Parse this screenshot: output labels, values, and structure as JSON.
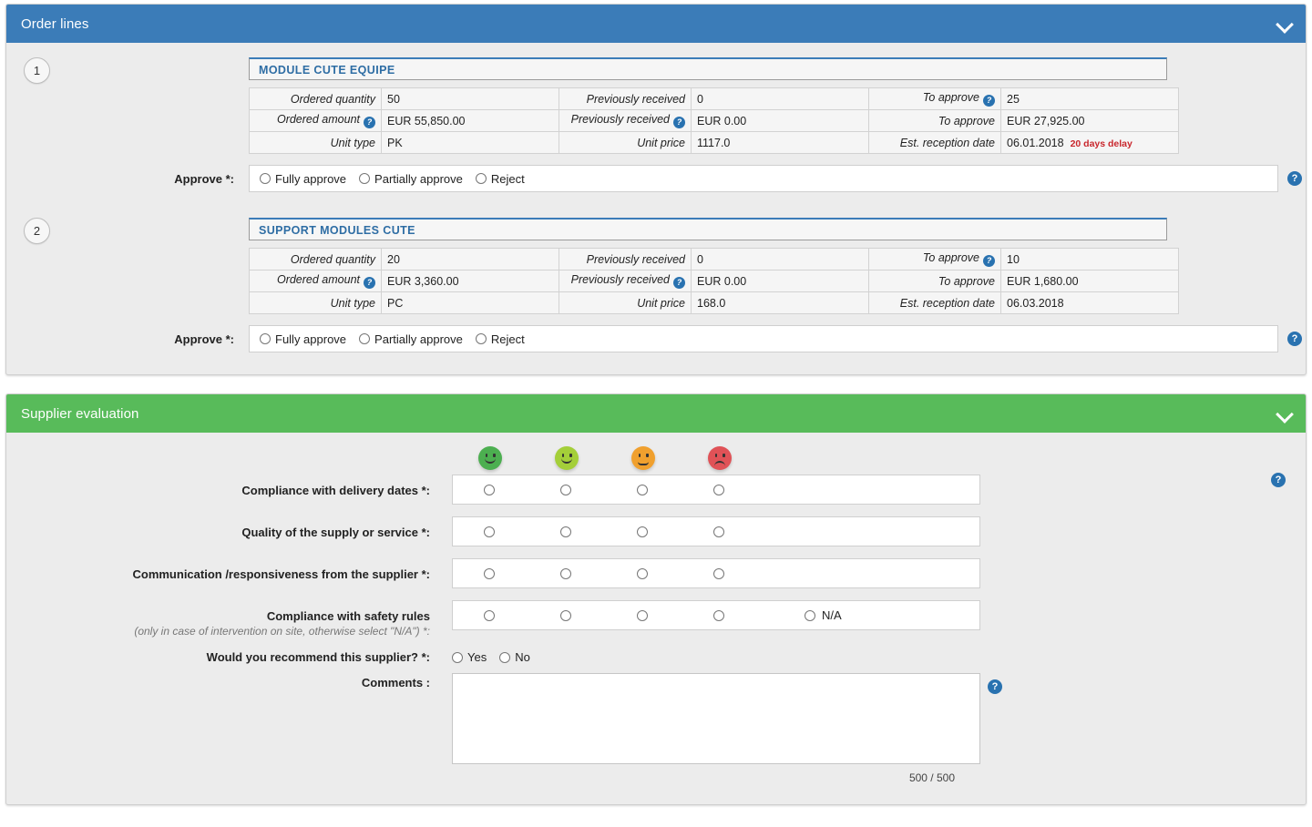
{
  "order_lines_panel": {
    "title": "Order lines",
    "collapse_icon": "chevron-down-icon",
    "lines": [
      {
        "step": "1",
        "title": "MODULE CUTE EQUIPE",
        "rows": [
          {
            "c1_label": "Ordered quantity",
            "c1_help": false,
            "c1_value": "50",
            "c2_label": "Previously received",
            "c2_help": false,
            "c2_value": "0",
            "c3_label": "To approve",
            "c3_help": true,
            "c3_value": "25"
          },
          {
            "c1_label": "Ordered amount",
            "c1_help": true,
            "c1_value": "EUR 55,850.00",
            "c2_label": "Previously received",
            "c2_help": true,
            "c2_value": "EUR 0.00",
            "c3_label": "To approve",
            "c3_help": false,
            "c3_value": "EUR 27,925.00"
          },
          {
            "c1_label": "Unit type",
            "c1_help": false,
            "c1_value": "PK",
            "c2_label": "Unit price",
            "c2_help": false,
            "c2_value": "1117.0",
            "c3_label": "Est. reception date",
            "c3_help": false,
            "c3_value": "06.01.2018",
            "c3_badge": "20 days delay"
          }
        ],
        "approve_label": "Approve *:",
        "approve_options": [
          "Fully approve",
          "Partially approve",
          "Reject"
        ],
        "approve_help_icon": "help-icon"
      },
      {
        "step": "2",
        "title": "SUPPORT MODULES CUTE",
        "rows": [
          {
            "c1_label": "Ordered quantity",
            "c1_help": false,
            "c1_value": "20",
            "c2_label": "Previously received",
            "c2_help": false,
            "c2_value": "0",
            "c3_label": "To approve",
            "c3_help": true,
            "c3_value": "10"
          },
          {
            "c1_label": "Ordered amount",
            "c1_help": true,
            "c1_value": "EUR 3,360.00",
            "c2_label": "Previously received",
            "c2_help": true,
            "c2_value": "EUR 0.00",
            "c3_label": "To approve",
            "c3_help": false,
            "c3_value": "EUR 1,680.00"
          },
          {
            "c1_label": "Unit type",
            "c1_help": false,
            "c1_value": "PC",
            "c2_label": "Unit price",
            "c2_help": false,
            "c2_value": "168.0",
            "c3_label": "Est. reception date",
            "c3_help": false,
            "c3_value": "06.03.2018",
            "c3_badge": ""
          }
        ],
        "approve_label": "Approve *:",
        "approve_options": [
          "Fully approve",
          "Partially approve",
          "Reject"
        ],
        "approve_help_icon": "help-icon"
      }
    ]
  },
  "supplier_evaluation_panel": {
    "title": "Supplier evaluation",
    "collapse_icon": "chevron-down-icon",
    "help_icon": "help-icon",
    "rating_scale": [
      {
        "name": "very-satisfied",
        "color": "#4caf50",
        "mouth": "happy"
      },
      {
        "name": "satisfied",
        "color": "#a4cf39",
        "mouth": "happy"
      },
      {
        "name": "neutral",
        "color": "#f0a02e",
        "mouth": "neutral"
      },
      {
        "name": "dissatisfied",
        "color": "#e05257",
        "mouth": "sad"
      }
    ],
    "criteria": [
      {
        "label": "Compliance with delivery dates *:",
        "sub": "",
        "options": 4,
        "na": false
      },
      {
        "label": "Quality of the supply or service *:",
        "sub": "",
        "options": 4,
        "na": false
      },
      {
        "label": "Communication /responsiveness from the supplier *:",
        "sub": "",
        "options": 4,
        "na": false
      },
      {
        "label": "Compliance with safety rules",
        "sub": "(only in case of intervention on site, otherwise select \"N/A\") *:",
        "options": 4,
        "na": true,
        "na_label": "N/A"
      }
    ],
    "recommend": {
      "label": "Would you recommend this supplier? *:",
      "options": [
        "Yes",
        "No"
      ]
    },
    "comments": {
      "label": "Comments :",
      "value": "",
      "placeholder": "",
      "char_count": "500 / 500",
      "help_icon": "help-icon"
    }
  },
  "colors": {
    "order_header": "#3b7cb8",
    "eval_header": "#58bb5a",
    "panel_body": "#ececec",
    "delay_text": "#c9272d",
    "line_title_text": "#2e6da4",
    "help_icon": "#2972b0"
  }
}
